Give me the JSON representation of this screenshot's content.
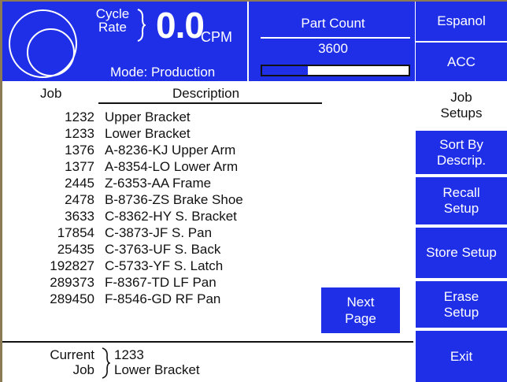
{
  "header": {
    "cycle_rate_label_line1": "Cycle",
    "cycle_rate_label_line2": "Rate",
    "rate_value": "0.0",
    "rate_unit": "CPM",
    "mode": "Mode: Production",
    "part_count_title": "Part Count",
    "part_count_value": "3600",
    "progress_fraction": 0.31
  },
  "sidebar": {
    "language_button": "Espanol",
    "acc_button": "ACC",
    "section_label_line1": "Job",
    "section_label_line2": "Setups",
    "sort_button_line1": "Sort By",
    "sort_button_line2": "Descrip.",
    "recall_button_line1": "Recall",
    "recall_button_line2": "Setup",
    "store_button": "Store Setup",
    "erase_button_line1": "Erase",
    "erase_button_line2": "Setup",
    "exit_button": "Exit"
  },
  "table": {
    "col_job": "Job",
    "col_description": "Description",
    "rows": [
      {
        "job": "1232",
        "description": "Upper Bracket"
      },
      {
        "job": "1233",
        "description": "Lower Bracket"
      },
      {
        "job": "1376",
        "description": "A-8236-KJ Upper Arm"
      },
      {
        "job": "1377",
        "description": "A-8354-LO Lower Arm"
      },
      {
        "job": "2445",
        "description": "Z-6353-AA Frame"
      },
      {
        "job": "2478",
        "description": "B-8736-ZS Brake Shoe"
      },
      {
        "job": "3633",
        "description": "C-8362-HY S. Bracket"
      },
      {
        "job": "17854",
        "description": "C-3873-JF S. Pan"
      },
      {
        "job": "25435",
        "description": "C-3763-UF S. Back"
      },
      {
        "job": "192827",
        "description": "C-5733-YF S. Latch"
      },
      {
        "job": "289373",
        "description": "F-8367-TD LF Pan"
      },
      {
        "job": "289450",
        "description": "F-8546-GD RF Pan"
      }
    ]
  },
  "next_page_line1": "Next",
  "next_page_line2": "Page",
  "current": {
    "label_line1": "Current",
    "label_line2": "Job",
    "job": "1233",
    "description": "Lower Bracket"
  },
  "colors": {
    "accent_blue": "#1f2fe8",
    "frame": "#8c7a55"
  }
}
